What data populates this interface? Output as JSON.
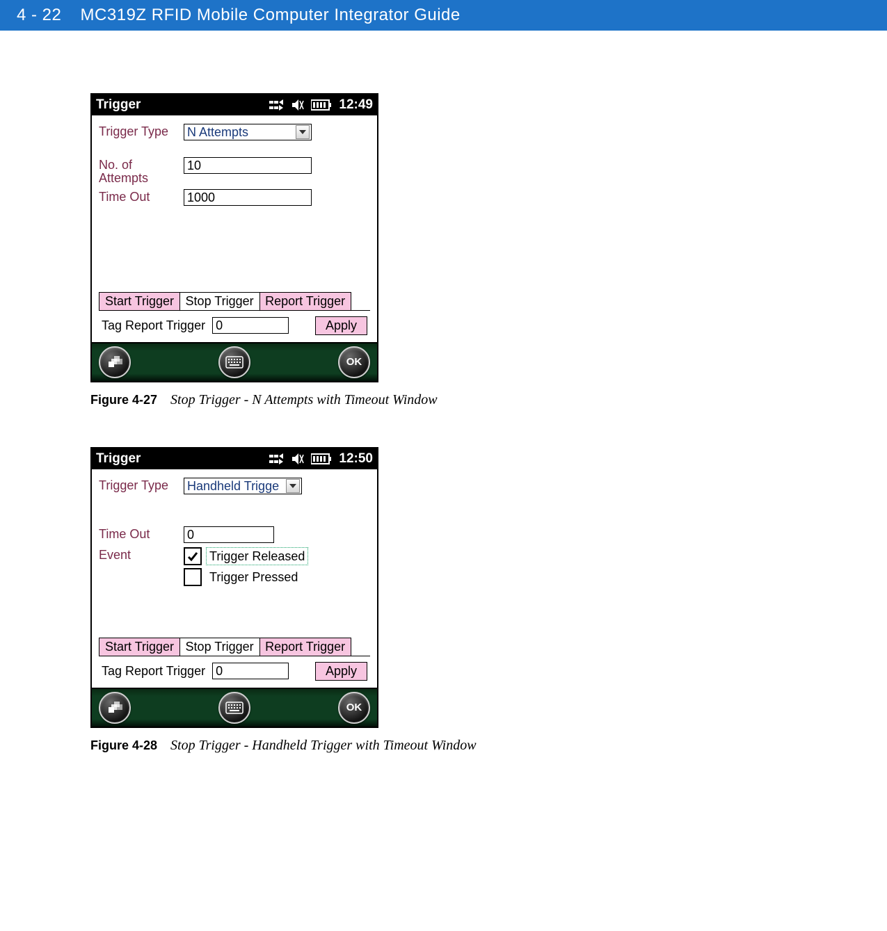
{
  "header": {
    "page_number": "4 - 22",
    "title": "MC319Z RFID Mobile Computer Integrator Guide"
  },
  "screen1": {
    "titlebar": {
      "title": "Trigger",
      "time": "12:49"
    },
    "fields": {
      "trigger_type_label": "Trigger Type",
      "trigger_type_value": "N Attempts",
      "attempts_label": "No. of\nAttempts",
      "attempts_value": "10",
      "timeout_label": "Time Out",
      "timeout_value": "1000"
    },
    "tabs": {
      "start": "Start Trigger",
      "stop": "Stop Trigger",
      "report": "Report Trigger"
    },
    "tag_report": {
      "label": "Tag Report Trigger",
      "value": "0",
      "apply": "Apply"
    },
    "softkeys": {
      "ok": "OK"
    }
  },
  "caption1": {
    "fignum": "Figure 4-27",
    "title": "Stop Trigger - N Attempts with Timeout Window"
  },
  "screen2": {
    "titlebar": {
      "title": "Trigger",
      "time": "12:50"
    },
    "fields": {
      "trigger_type_label": "Trigger Type",
      "trigger_type_value": "Handheld Trigge",
      "timeout_label": "Time Out",
      "timeout_value": "0",
      "event_label": "Event",
      "event_released": "Trigger Released",
      "event_pressed": "Trigger Pressed"
    },
    "tabs": {
      "start": "Start Trigger",
      "stop": "Stop Trigger",
      "report": "Report Trigger"
    },
    "tag_report": {
      "label": "Tag Report Trigger",
      "value": "0",
      "apply": "Apply"
    },
    "softkeys": {
      "ok": "OK"
    }
  },
  "caption2": {
    "fignum": "Figure 4-28",
    "title": "Stop Trigger - Handheld Trigger with Timeout Window"
  }
}
